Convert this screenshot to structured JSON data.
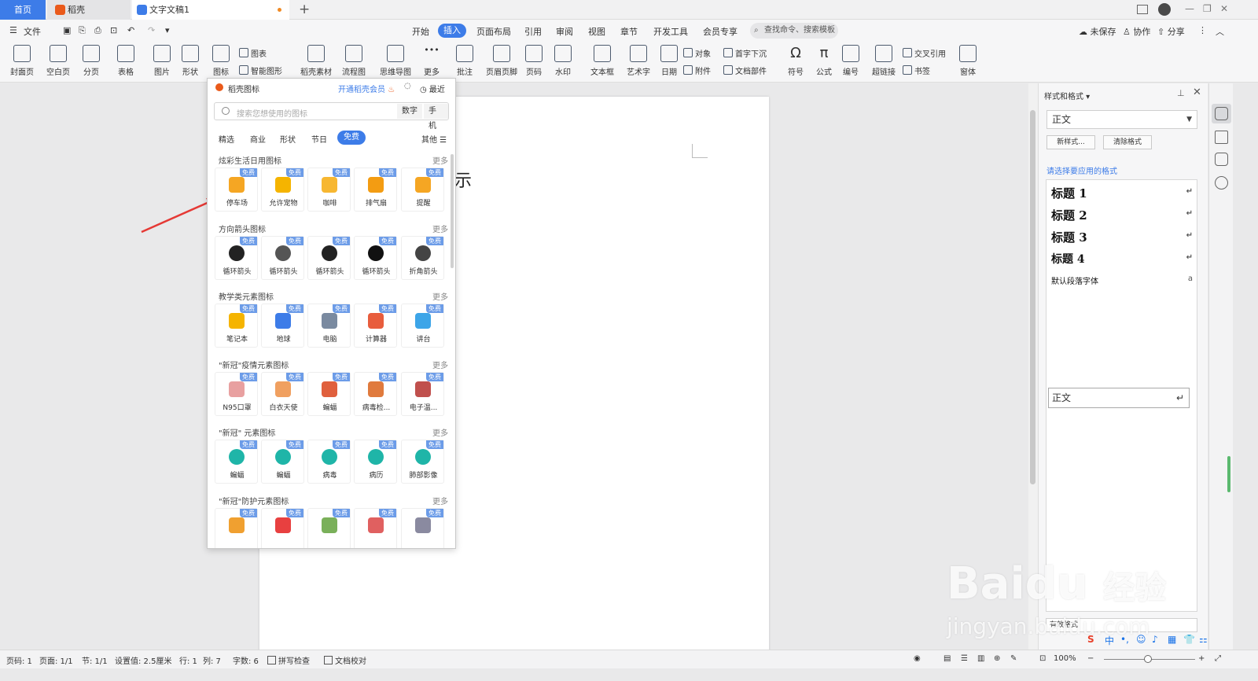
{
  "tabs": {
    "home": "首页",
    "daoke": "稻壳",
    "doc": "文字文稿1"
  },
  "menubar": {
    "file": "文件",
    "items": [
      "开始",
      "插入",
      "页面布局",
      "引用",
      "审阅",
      "视图",
      "章节",
      "开发工具",
      "会员专享"
    ],
    "active": "插入",
    "search": "查找命令、搜索模板",
    "unsaved": "未保存",
    "collab": "协作",
    "share": "分享"
  },
  "ribbon": {
    "big": [
      "封面页",
      "空白页",
      "分页",
      "表格",
      "图片",
      "形状",
      "图标",
      "稻壳素材",
      "流程图",
      "思维导图",
      "更多",
      "批注",
      "页眉页脚",
      "页码",
      "水印",
      "文本框",
      "艺术字",
      "日期",
      "符号",
      "公式",
      "编号",
      "超链接",
      "窗体"
    ],
    "small": {
      "chart": "图表",
      "smartart": "智能图形",
      "object": "对象",
      "attachment": "附件",
      "dropcap": "首字下沉",
      "docpart": "文档部件",
      "crossref": "交叉引用",
      "bookmark": "书签"
    }
  },
  "document": {
    "visible_char": "示"
  },
  "icon_popup": {
    "title": "稻壳图标",
    "vip": "开通稻壳会员",
    "recent": "最近",
    "search_placeholder": "搜索您想使用的图标",
    "search_options": [
      "数字",
      "手机"
    ],
    "categories": [
      "精选",
      "商业",
      "形状",
      "节日",
      "免费"
    ],
    "active_category": "免费",
    "other": "其他",
    "badge": "免费",
    "more": "更多",
    "sections": [
      {
        "title": "炫彩生活日用图标",
        "items": [
          {
            "name": "停车场",
            "color": "#f5a623"
          },
          {
            "name": "允许宠物",
            "color": "#f5b400"
          },
          {
            "name": "咖啡",
            "color": "#f7b731"
          },
          {
            "name": "排气扇",
            "color": "#f39c12"
          },
          {
            "name": "提醒",
            "color": "#f5a623"
          }
        ]
      },
      {
        "title": "方向箭头图标",
        "items": [
          {
            "name": "循环箭头",
            "color": "#222222"
          },
          {
            "name": "循环箭头",
            "color": "#555555"
          },
          {
            "name": "循环箭头",
            "color": "#222222"
          },
          {
            "name": "循环箭头",
            "color": "#111111"
          },
          {
            "name": "折角箭头",
            "color": "#444444"
          }
        ]
      },
      {
        "title": "教学类元素图标",
        "items": [
          {
            "name": "笔记本",
            "color": "#f5b400"
          },
          {
            "name": "地球",
            "color": "#3d7ce8"
          },
          {
            "name": "电脑",
            "color": "#7a8aa0"
          },
          {
            "name": "计算器",
            "color": "#e85d3d"
          },
          {
            "name": "讲台",
            "color": "#3da5e8"
          }
        ]
      },
      {
        "title": "\"新冠\"疫情元素图标",
        "items": [
          {
            "name": "N95口罩",
            "color": "#e8a0a0"
          },
          {
            "name": "白衣天使",
            "color": "#f0a060"
          },
          {
            "name": "蝙蝠",
            "color": "#e0603d"
          },
          {
            "name": "病毒检...",
            "color": "#e07a3d"
          },
          {
            "name": "电子温...",
            "color": "#c0504d"
          }
        ]
      },
      {
        "title": "\"新冠\" 元素图标",
        "items": [
          {
            "name": "蝙蝠",
            "color": "#1fb5a8"
          },
          {
            "name": "蝙蝠",
            "color": "#1fb5a8"
          },
          {
            "name": "病毒",
            "color": "#1fb5a8"
          },
          {
            "name": "病历",
            "color": "#1fb5a8"
          },
          {
            "name": "肺部影像",
            "color": "#1fb5a8"
          }
        ]
      },
      {
        "title": "\"新冠\"防护元素图标",
        "items": [
          {
            "name": "",
            "color": "#f0a030"
          },
          {
            "name": "",
            "color": "#e84040"
          },
          {
            "name": "",
            "color": "#7ab05a"
          },
          {
            "name": "",
            "color": "#e06060"
          },
          {
            "name": "",
            "color": "#8a8aa0"
          }
        ]
      }
    ]
  },
  "styles_pane": {
    "title": "样式和格式",
    "current": "正文",
    "new_style": "新样式...",
    "clear_format": "清除格式",
    "hint": "请选择要应用的格式",
    "styles": [
      {
        "name": "标题 1",
        "mark": "↵"
      },
      {
        "name": "标题 2",
        "mark": "↵"
      },
      {
        "name": "标题 3",
        "mark": "↵"
      },
      {
        "name": "标题 4",
        "mark": "↵"
      },
      {
        "name": "默认段落字体",
        "mark": "a"
      },
      {
        "name": "正文",
        "mark": "↵"
      }
    ],
    "show": "有效格式"
  },
  "statusbar": {
    "page_num": "页码: 1",
    "pages": "页面: 1/1",
    "section": "节: 1/1",
    "setting": "设置值: 2.5厘米",
    "row": "行: 1",
    "col": "列: 7",
    "words": "字数: 6",
    "spell": "拼写检查",
    "proof": "文档校对",
    "zoom": "100%"
  },
  "ime": {
    "labels": [
      "中",
      "•,",
      "☺",
      "♪",
      "▦",
      "👕",
      "⚏"
    ]
  },
  "watermark": {
    "main": "Bai",
    "paw": "du",
    "jy": "经验",
    "url": "jingyan.baidu.com"
  },
  "colors": {
    "accent": "#3d7ce8",
    "arrow": "#e53935",
    "vip": "#ea5a1b",
    "free_badge": "#6c9ce8"
  }
}
